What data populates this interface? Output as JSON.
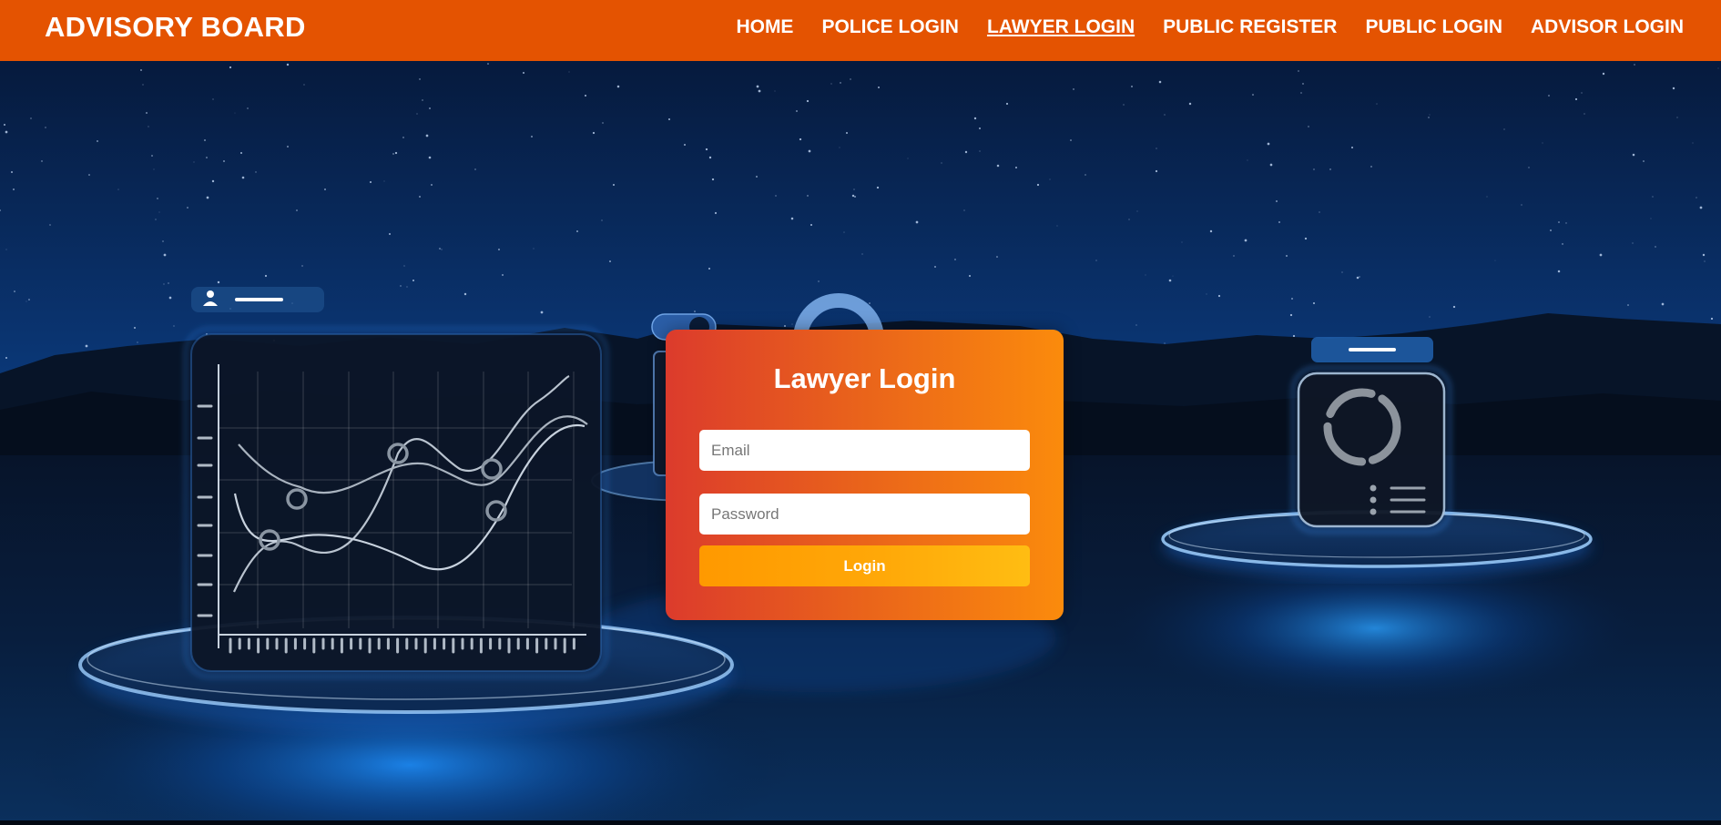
{
  "brand": {
    "title": "ADVISORY BOARD"
  },
  "nav": {
    "items": [
      {
        "label": "HOME"
      },
      {
        "label": "POLICE LOGIN"
      },
      {
        "label": "LAWYER LOGIN",
        "active": true
      },
      {
        "label": "PUBLIC REGISTER"
      },
      {
        "label": "PUBLIC LOGIN"
      },
      {
        "label": "ADVISOR LOGIN"
      }
    ]
  },
  "login": {
    "title": "Lawyer Login",
    "email_placeholder": "Email",
    "email_value": "",
    "password_placeholder": "Password",
    "password_value": "",
    "button_label": "Login"
  },
  "colors": {
    "nav_bg": "#e45301",
    "card_gradient_start": "#dc3b2c",
    "card_gradient_end": "#fb8b0c",
    "button_color": "#ffa808",
    "background": "#04214a"
  },
  "icons": [
    "user-icon",
    "line-chart-icon",
    "donut-chart-icon",
    "list-icon",
    "toggle-icon"
  ]
}
